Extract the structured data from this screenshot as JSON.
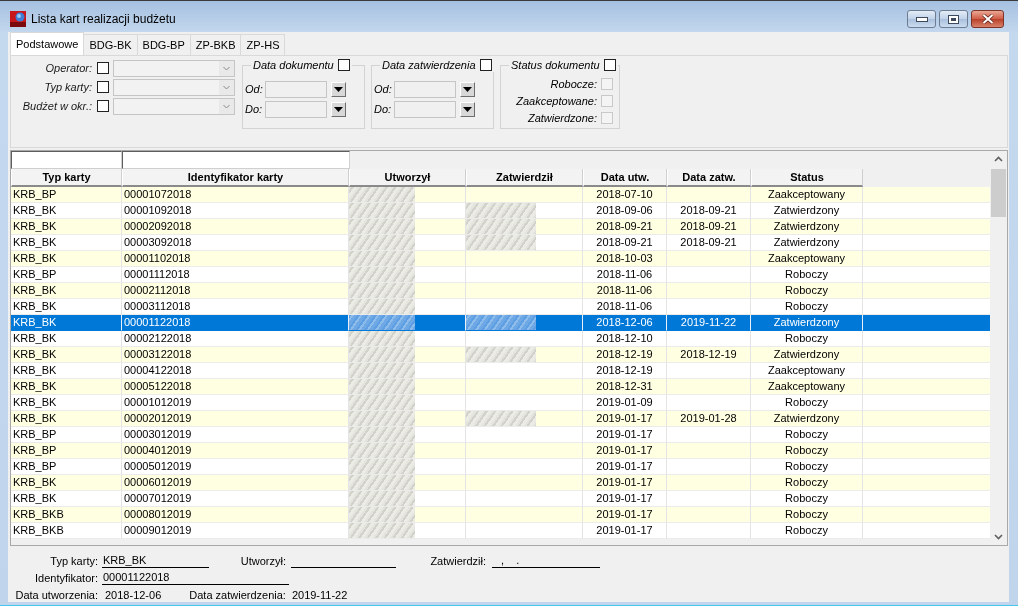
{
  "window": {
    "title": "Lista kart realizacji budżetu"
  },
  "tabs": [
    {
      "label": "Podstawowe",
      "selected": true
    },
    {
      "label": "BDG-BK",
      "selected": false
    },
    {
      "label": "BDG-BP",
      "selected": false
    },
    {
      "label": "ZP-BKB",
      "selected": false
    },
    {
      "label": "ZP-HS",
      "selected": false
    }
  ],
  "filters": {
    "selectors": [
      {
        "label": "Operator:",
        "checked": false,
        "disabled": true
      },
      {
        "label": "Typ karty:",
        "checked": false,
        "disabled": true
      },
      {
        "label": "Budżet w okr.:",
        "checked": false,
        "disabled": true
      }
    ],
    "date_ranges": [
      {
        "title": "Data dokumentu",
        "checked": false,
        "disabled": true,
        "from_label": "Od:",
        "to_label": "Do:"
      },
      {
        "title": "Data zatwierdzenia",
        "checked": false,
        "disabled": true,
        "from_label": "Od:",
        "to_label": "Do:"
      }
    ],
    "status": {
      "title": "Status dokumentu",
      "checked": false,
      "options": [
        {
          "label": "Robocze:",
          "checked": false,
          "disabled": true
        },
        {
          "label": "Zaakceptowane:",
          "checked": false,
          "disabled": true
        },
        {
          "label": "Zatwierdzone:",
          "checked": false,
          "disabled": true
        }
      ]
    }
  },
  "table": {
    "columns": [
      "Typ karty",
      "Identyfikator karty",
      "Utworzył",
      "Zatwierdził",
      "Data utw.",
      "Data zatw.",
      "Status"
    ],
    "rows": [
      {
        "type": "KRB_BP",
        "id": "00001072018",
        "creator_blurred": true,
        "approver_blurred": false,
        "created": "2018-07-10",
        "status": "Zaakceptowany",
        "selected": false
      },
      {
        "type": "KRB_BK",
        "id": "00001092018",
        "creator_blurred": true,
        "approver_blurred": true,
        "created": "2018-09-06",
        "approved": "2018-09-21",
        "status": "Zatwierdzony",
        "selected": false
      },
      {
        "type": "KRB_BK",
        "id": "00002092018",
        "creator_blurred": true,
        "approver_blurred": true,
        "created": "2018-09-21",
        "approved": "2018-09-21",
        "status": "Zatwierdzony",
        "selected": false
      },
      {
        "type": "KRB_BK",
        "id": "00003092018",
        "creator_blurred": true,
        "approver_blurred": true,
        "created": "2018-09-21",
        "approved": "2018-09-21",
        "status": "Zatwierdzony",
        "selected": false
      },
      {
        "type": "KRB_BK",
        "id": "00001102018",
        "creator_blurred": true,
        "approver_blurred": false,
        "created": "2018-10-03",
        "status": "Zaakceptowany",
        "selected": false
      },
      {
        "type": "KRB_BP",
        "id": "00001112018",
        "creator_blurred": true,
        "approver_blurred": false,
        "created": "2018-11-06",
        "status": "Roboczy",
        "selected": false
      },
      {
        "type": "KRB_BK",
        "id": "00002112018",
        "creator_blurred": true,
        "approver_blurred": false,
        "created": "2018-11-06",
        "status": "Roboczy",
        "selected": false
      },
      {
        "type": "KRB_BK",
        "id": "00003112018",
        "creator_blurred": true,
        "approver_blurred": false,
        "created": "2018-11-06",
        "status": "Roboczy",
        "selected": false
      },
      {
        "type": "KRB_BK",
        "id": "00001122018",
        "creator_blurred": true,
        "approver_blurred": true,
        "created": "2018-12-06",
        "approved": "2019-11-22",
        "status": "Zatwierdzony",
        "selected": true
      },
      {
        "type": "KRB_BK",
        "id": "00002122018",
        "creator_blurred": true,
        "approver_blurred": false,
        "created": "2018-12-10",
        "status": "Roboczy",
        "selected": false
      },
      {
        "type": "KRB_BK",
        "id": "00003122018",
        "creator_blurred": true,
        "approver_blurred": true,
        "created": "2018-12-19",
        "approved": "2018-12-19",
        "status": "Zatwierdzony",
        "selected": false
      },
      {
        "type": "KRB_BK",
        "id": "00004122018",
        "creator_blurred": true,
        "approver_blurred": false,
        "created": "2018-12-19",
        "status": "Zaakceptowany",
        "selected": false
      },
      {
        "type": "KRB_BK",
        "id": "00005122018",
        "creator_blurred": true,
        "approver_blurred": false,
        "created": "2018-12-31",
        "status": "Zaakceptowany",
        "selected": false
      },
      {
        "type": "KRB_BK",
        "id": "00001012019",
        "creator_blurred": true,
        "approver_blurred": false,
        "created": "2019-01-09",
        "status": "Roboczy",
        "selected": false
      },
      {
        "type": "KRB_BK",
        "id": "00002012019",
        "creator_blurred": true,
        "approver_blurred": true,
        "created": "2019-01-17",
        "approved": "2019-01-28",
        "status": "Zatwierdzony",
        "selected": false
      },
      {
        "type": "KRB_BP",
        "id": "00003012019",
        "creator_blurred": true,
        "approver_blurred": false,
        "created": "2019-01-17",
        "status": "Roboczy",
        "selected": false
      },
      {
        "type": "KRB_BP",
        "id": "00004012019",
        "creator_blurred": true,
        "approver_blurred": false,
        "created": "2019-01-17",
        "status": "Roboczy",
        "selected": false
      },
      {
        "type": "KRB_BP",
        "id": "00005012019",
        "creator_blurred": true,
        "approver_blurred": false,
        "created": "2019-01-17",
        "status": "Roboczy",
        "selected": false
      },
      {
        "type": "KRB_BK",
        "id": "00006012019",
        "creator_blurred": true,
        "approver_blurred": false,
        "created": "2019-01-17",
        "status": "Roboczy",
        "selected": false
      },
      {
        "type": "KRB_BK",
        "id": "00007012019",
        "creator_blurred": true,
        "approver_blurred": false,
        "created": "2019-01-17",
        "status": "Roboczy",
        "selected": false
      },
      {
        "type": "KRB_BKB",
        "id": "00008012019",
        "creator_blurred": true,
        "approver_blurred": false,
        "created": "2019-01-17",
        "status": "Roboczy",
        "selected": false
      },
      {
        "type": "KRB_BKB",
        "id": "00009012019",
        "creator_blurred": true,
        "approver_blurred": false,
        "created": "2019-01-17",
        "status": "Roboczy",
        "selected": false
      }
    ]
  },
  "details": {
    "type_label": "Typ karty:",
    "type_value": "KRB_BK",
    "creator_label": "Utworzył:",
    "approver_label": "Zatwierdził:",
    "approver_value": ",    .",
    "id_label": "Identyfikator:",
    "id_value": "00001122018",
    "created_label": "Data utworzenia:",
    "created_value": "2018-12-06",
    "approved_label": "Data zatwierdzenia:",
    "approved_value": "2019-11-22"
  }
}
